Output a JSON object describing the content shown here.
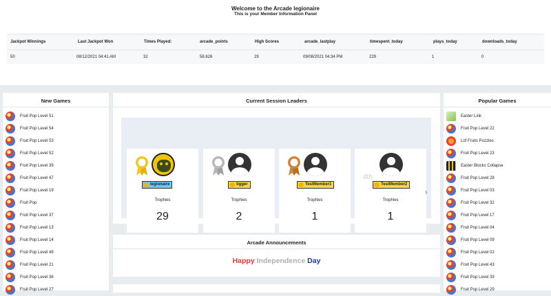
{
  "header": {
    "title": "Welcome to the Arcade legionaire",
    "subtitle": "This is your Member Information Panel"
  },
  "stats": {
    "columns": [
      "Jackpot Winnings",
      "Last Jackpot Won",
      "Times Played:",
      "arcade_points",
      "High Scores",
      "arcade_lastplay",
      "timespent_today",
      "plays_today",
      "downloads_today"
    ],
    "values": [
      "50",
      "08/12/2021 04:41 AM",
      "32",
      "58,626",
      "29",
      "09/08/2021 04:34 PM",
      "229",
      "1",
      "0"
    ]
  },
  "new_games": {
    "title": "New Games",
    "items": [
      "Fruit Pop Level 51",
      "Fruit Pop Level 54",
      "Fruit Pop Level 53",
      "Fruit Pop Level 52",
      "Fruit Pop Level 39",
      "Fruit Pop Level 47",
      "Fruit Pop Level 19",
      "Fruit Pop",
      "Fruit Pop Level 37",
      "Fruit Pop Level 13",
      "Fruit Pop Level 14",
      "Fruit Pop Level 49",
      "Fruit Pop Level 21",
      "Fruit Pop Level 36",
      "Fruit Pop Level 27"
    ]
  },
  "popular_games": {
    "title": "Popular Games",
    "items": [
      "Easter Link",
      "Fruit Pop Level 22",
      "Lof Fruits Puzzles",
      "Fruit Pop Level 23",
      "Easter Blocks Collapse",
      "Fruit Pop Level 28",
      "Fruit Pop Level 03",
      "Fruit Pop Level 32",
      "Fruit Pop Level 17",
      "Fruit Pop Level 04",
      "Fruit Pop Level 09",
      "Fruit Pop Level 02",
      "Fruit Pop Level 43",
      "Fruit Pop Level 39",
      "Fruit Pop Level 29"
    ]
  },
  "leaders": {
    "title": "Current Session Leaders",
    "trophies_label": "Trophies",
    "cards": [
      {
        "rank": "1st",
        "rank_icon": "gold-ribbon-icon",
        "name": "legionaire",
        "trophies": "29"
      },
      {
        "rank": "2nd",
        "rank_icon": "silver-ribbon-icon",
        "name": "tigger",
        "trophies": "2"
      },
      {
        "rank": "3rd",
        "rank_icon": "bronze-ribbon-icon",
        "name": "TestMember1",
        "trophies": "1"
      },
      {
        "rank": "4th",
        "rank_icon": "",
        "name": "TestMember2",
        "trophies": "1"
      }
    ],
    "next_icon": "chevron-right-icon"
  },
  "announcements": {
    "title": "Arcade Announcements",
    "words": [
      "Happy",
      "Independence",
      "Day"
    ],
    "colors": [
      "#e53935",
      "#b0b0b0",
      "#1e3a9c"
    ]
  },
  "colors": {
    "gold": "#f3c623",
    "silver": "#b8b8b8",
    "bronze": "#d2843a",
    "name_tag": "#f7d64a",
    "name_tag_self": "#6ec6ff"
  }
}
